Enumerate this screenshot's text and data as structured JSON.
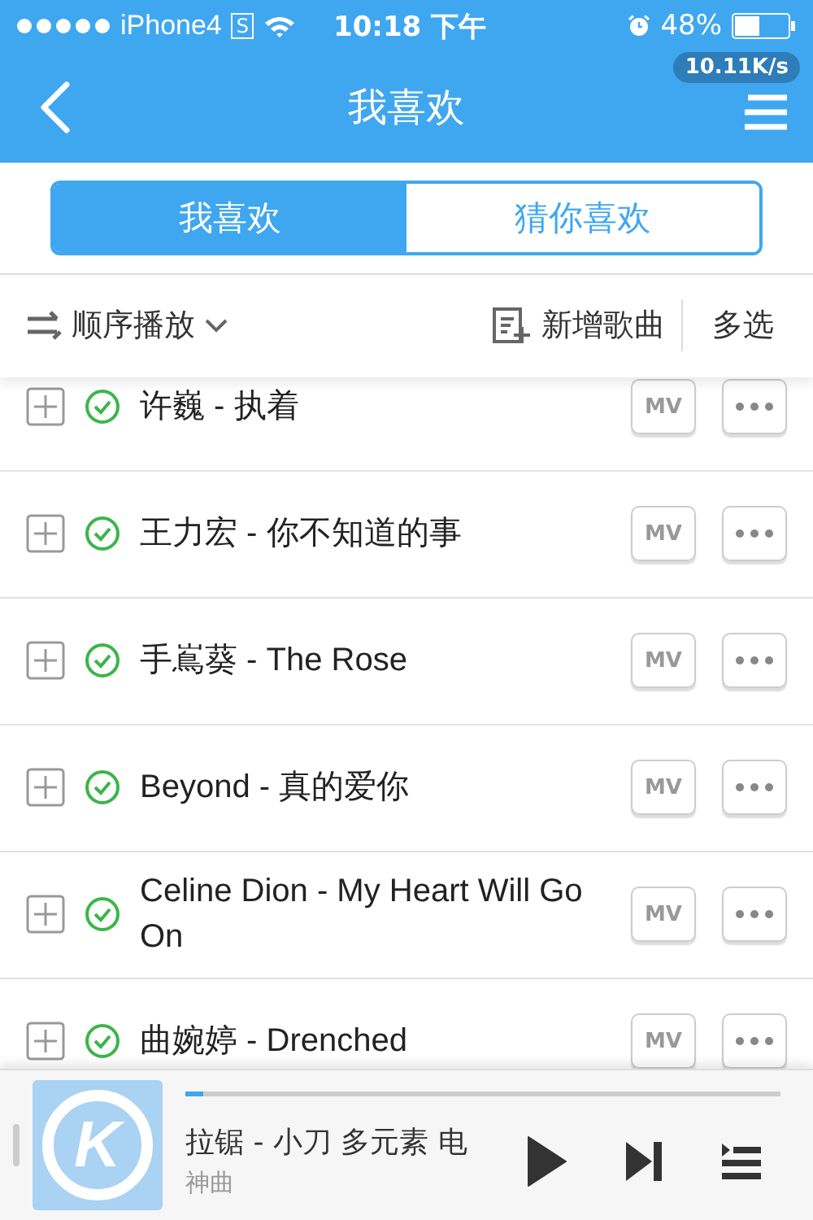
{
  "status_bar": {
    "carrier": "iPhone4",
    "carrier_badge": "S",
    "time": "10:18 下午",
    "battery": "48%",
    "speed": "10.11K/s"
  },
  "header": {
    "title": "我喜欢"
  },
  "tabs": [
    {
      "label": "我喜欢",
      "selected": true
    },
    {
      "label": "猜你喜欢",
      "selected": false
    }
  ],
  "toolbar": {
    "play_mode": "顺序播放",
    "add_song": "新增歌曲",
    "multi_select": "多选"
  },
  "songs": [
    {
      "title": "许巍 - 执着",
      "downloaded": true,
      "mv": "MV"
    },
    {
      "title": "王力宏 - 你不知道的事",
      "downloaded": true,
      "mv": "MV"
    },
    {
      "title": "手嶌葵 - The Rose",
      "downloaded": true,
      "mv": "MV"
    },
    {
      "title": "Beyond - 真的爱你",
      "downloaded": true,
      "mv": "MV"
    },
    {
      "title": "Celine Dion - My Heart Will Go On",
      "downloaded": true,
      "mv": "MV"
    },
    {
      "title": "曲婉婷 - Drenched",
      "downloaded": true,
      "mv": "MV"
    }
  ],
  "player": {
    "logo_letter": "K",
    "title": "拉锯 - 小刀 多元素 电",
    "subtitle": "神曲",
    "level": 0.03,
    "playing": false
  }
}
